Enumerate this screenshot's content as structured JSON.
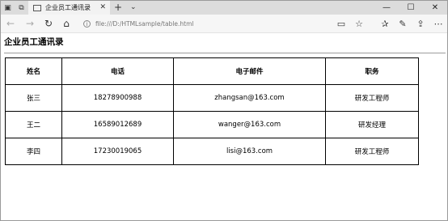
{
  "browser": {
    "tab_title": "企业员工通讯录",
    "url": "file:///D:/HTMLsample/table.html",
    "icons": {
      "tab_actions": "window-stack-icon",
      "back_tabs": "back-tabs-icon",
      "tab_favicon": "page-icon",
      "tab_close": "close-icon",
      "new_tab": "plus-icon",
      "tab_menu": "chevron-down-icon",
      "minimize": "minimize-icon",
      "maximize": "maximize-icon",
      "close_window": "close-icon",
      "back": "arrow-left-icon",
      "forward": "arrow-right-icon",
      "refresh": "refresh-icon",
      "home": "home-icon",
      "site_info": "info-icon",
      "reading_view": "book-icon",
      "favorite": "star-icon",
      "favorites_list": "favorites-icon",
      "pen": "pen-icon",
      "share": "share-icon",
      "more": "more-icon"
    }
  },
  "page": {
    "heading": "企业员工通讯录",
    "table": {
      "headers": [
        "姓名",
        "电话",
        "电子邮件",
        "职务"
      ],
      "rows": [
        [
          "张三",
          "18278900988",
          "zhangsan@163.com",
          "研发工程师"
        ],
        [
          "王二",
          "16589012689",
          "wanger@163.com",
          "研发经理"
        ],
        [
          "李四",
          "17230019065",
          "lisi@163.com",
          "研发工程师"
        ]
      ]
    }
  }
}
